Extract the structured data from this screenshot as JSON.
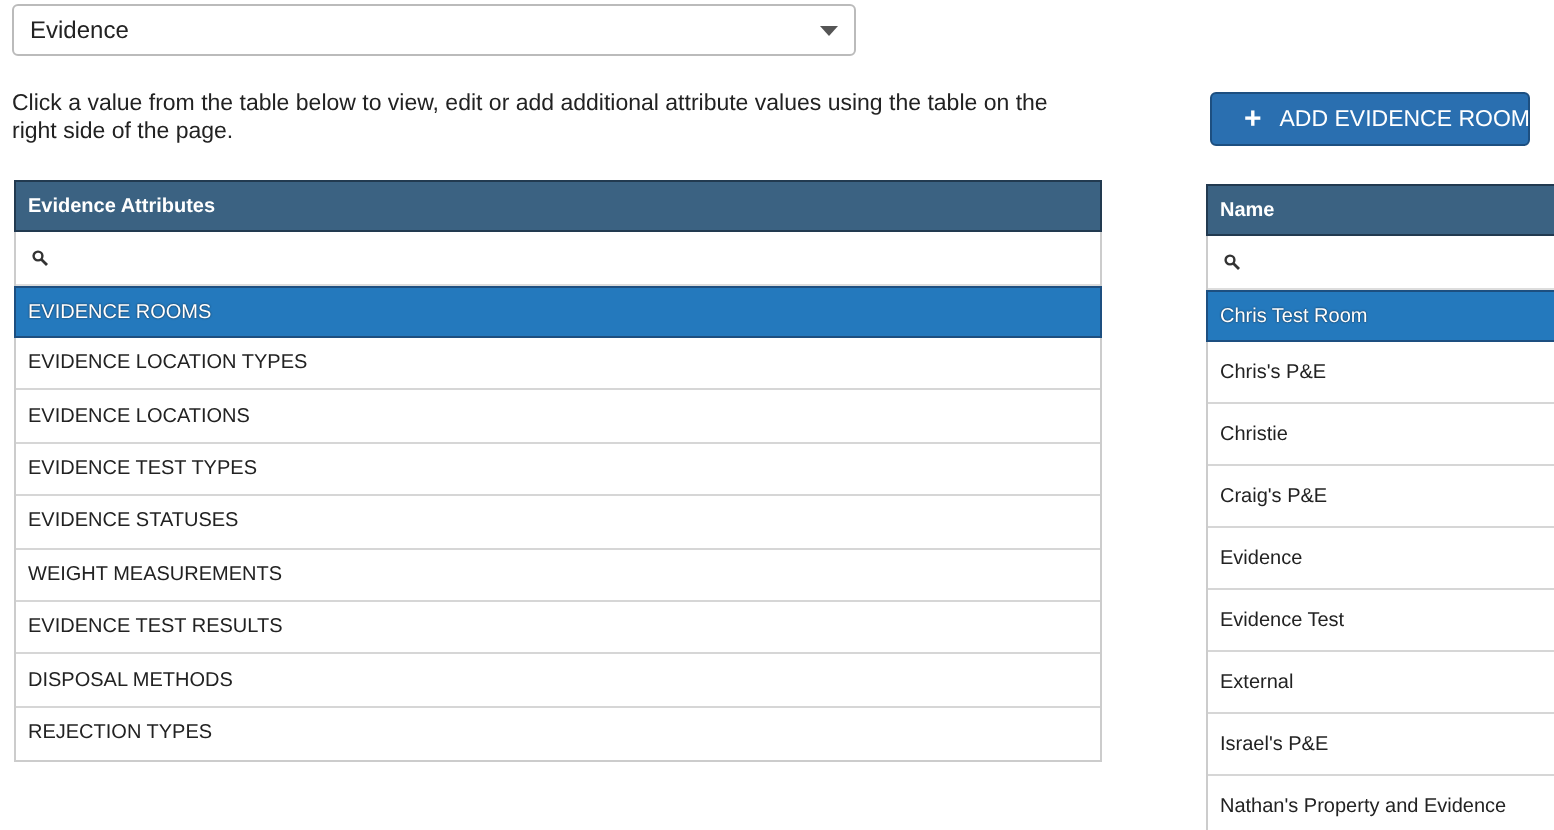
{
  "category_select": {
    "value": "Evidence"
  },
  "instructions": "Click a value from the table below to view, edit or add additional attribute values using the table on the right side of the page.",
  "add_button": {
    "icon": "+",
    "label": "ADD EVIDENCE ROOM"
  },
  "attributes_table": {
    "header": "Evidence Attributes",
    "rows": [
      {
        "label": "EVIDENCE ROOMS",
        "selected": true
      },
      {
        "label": "EVIDENCE LOCATION TYPES",
        "selected": false
      },
      {
        "label": "EVIDENCE LOCATIONS",
        "selected": false
      },
      {
        "label": "EVIDENCE TEST TYPES",
        "selected": false
      },
      {
        "label": "EVIDENCE STATUSES",
        "selected": false
      },
      {
        "label": "WEIGHT MEASUREMENTS",
        "selected": false
      },
      {
        "label": "EVIDENCE TEST RESULTS",
        "selected": false
      },
      {
        "label": "DISPOSAL METHODS",
        "selected": false
      },
      {
        "label": "REJECTION TYPES",
        "selected": false
      }
    ]
  },
  "values_table": {
    "header": "Name",
    "rows": [
      {
        "label": "Chris Test Room",
        "selected": true
      },
      {
        "label": "Chris's P&E",
        "selected": false
      },
      {
        "label": "Christie",
        "selected": false
      },
      {
        "label": "Craig's P&E",
        "selected": false
      },
      {
        "label": "Evidence",
        "selected": false
      },
      {
        "label": "Evidence Test",
        "selected": false
      },
      {
        "label": "External",
        "selected": false
      },
      {
        "label": "Israel's P&E",
        "selected": false
      },
      {
        "label": "Nathan's Property and Evidence",
        "selected": false
      }
    ]
  }
}
